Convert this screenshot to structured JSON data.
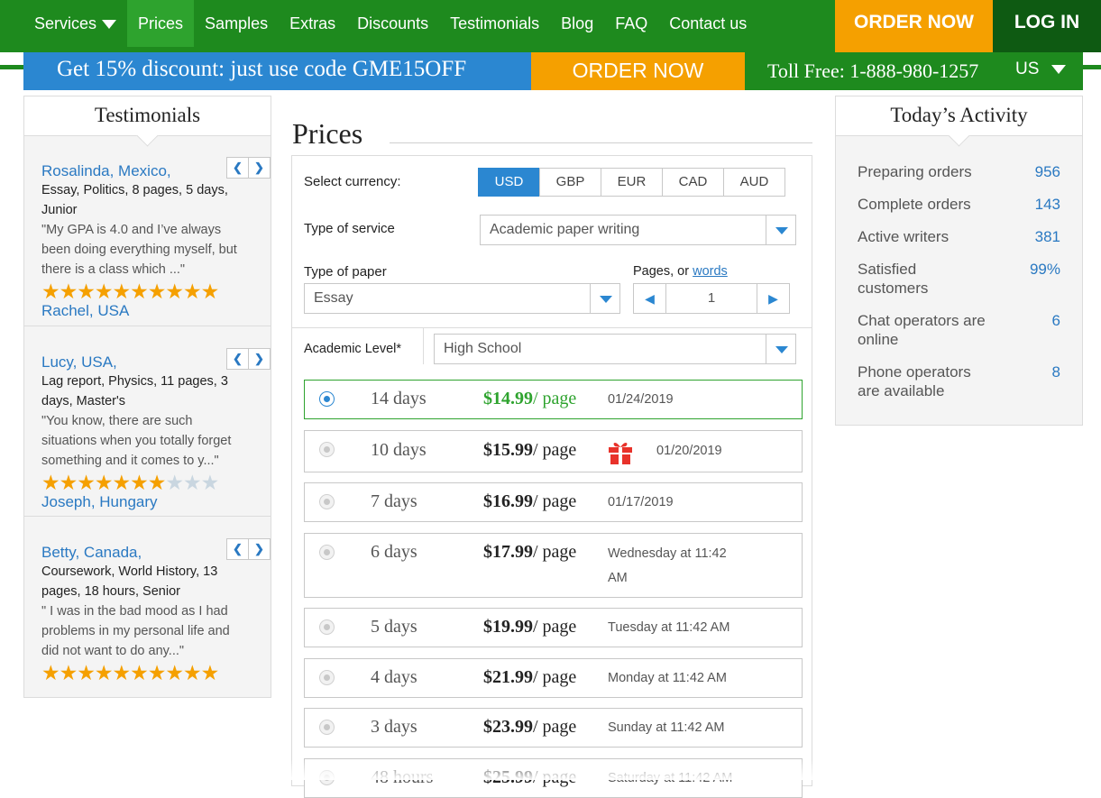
{
  "nav": {
    "links": [
      "Services",
      "Prices",
      "Samples",
      "Extras",
      "Discounts",
      "Testimonials",
      "Blog",
      "FAQ",
      "Contact us"
    ],
    "order_now": "ORDER NOW",
    "log_in": "LOG IN"
  },
  "promo": {
    "discount": "Get 15% discount: just use code GME15OFF",
    "order_now": "ORDER NOW",
    "toll_free": "Toll Free: 1-888-980-1257",
    "country": "US"
  },
  "testimonials": {
    "title": "Testimonials",
    "items": [
      {
        "name": "Rosalinda, Mexico,",
        "meta": "Essay, Politics, 8 pages, 5 days, Junior",
        "quote": "\"My GPA is 4.0 and I’ve always been doing everything myself, but there is a class which ...\"",
        "stars": 10,
        "next": "Rachel, USA"
      },
      {
        "name": "Lucy, USA,",
        "meta": "Lag report, Physics, 11 pages, 3 days, Master's",
        "quote": "\"You know, there are such situations when you totally forget something and it comes to y...\"",
        "stars": 7,
        "next": "Joseph, Hungary"
      },
      {
        "name": "Betty, Canada,",
        "meta": "Coursework, World History, 13 pages, 18 hours, Senior",
        "quote": "\" I was in the bad mood as I had problems in my personal life and did not want to do any...\"",
        "stars": 10,
        "next": ""
      }
    ]
  },
  "prices": {
    "title": "Prices",
    "currency_label": "Select currency:",
    "currencies": [
      "USD",
      "GBP",
      "EUR",
      "CAD",
      "AUD"
    ],
    "selected_currency": "USD",
    "service_label": "Type of service",
    "service_value": "Academic paper writing",
    "paper_label": "Type of paper",
    "paper_value": "Essay",
    "pages_label": "Pages, or",
    "pages_words_link": "words",
    "pages_value": "1",
    "level_label": "Academic Level*",
    "level_value": "High School",
    "options": [
      {
        "days": "14 days",
        "price": "$14.99",
        "unit": "/ page",
        "date": "01/24/2019",
        "selected": true
      },
      {
        "days": "10 days",
        "price": "$15.99",
        "unit": "/ page",
        "date": "01/20/2019",
        "gift": true
      },
      {
        "days": "7 days",
        "price": "$16.99",
        "unit": "/ page",
        "date": "01/17/2019"
      },
      {
        "days": "6 days",
        "price": "$17.99",
        "unit": "/ page",
        "date": "Wednesday at 11:42 AM"
      },
      {
        "days": "5 days",
        "price": "$19.99",
        "unit": "/ page",
        "date": "Tuesday at 11:42 AM"
      },
      {
        "days": "4 days",
        "price": "$21.99",
        "unit": "/ page",
        "date": "Monday at 11:42 AM"
      },
      {
        "days": "3 days",
        "price": "$23.99",
        "unit": "/ page",
        "date": "Sunday at 11:42 AM"
      },
      {
        "days": "48 hours",
        "price": "$25.99",
        "unit": "/ page",
        "date": "Saturday at 11:42 AM"
      }
    ]
  },
  "activity": {
    "title": "Today’s Activity",
    "rows": [
      {
        "label": "Preparing orders",
        "value": "956"
      },
      {
        "label": "Complete orders",
        "value": "143"
      },
      {
        "label": "Active writers",
        "value": "381"
      },
      {
        "label": "Satisfied customers",
        "value": "99%"
      },
      {
        "label": "Chat operators are online",
        "value": "6"
      },
      {
        "label": "Phone operators are available",
        "value": "8"
      }
    ]
  },
  "colors": {
    "green": "#1e8a1e",
    "blue": "#2b87d1",
    "orange": "#f5a000",
    "dark_green": "#0e5a12"
  }
}
